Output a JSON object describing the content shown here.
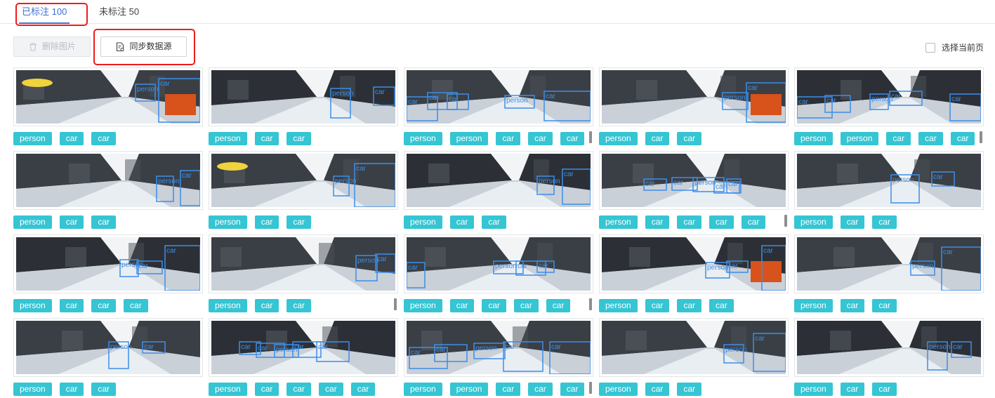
{
  "tabs": {
    "labeled": "已标注 100",
    "unlabeled": "未标注 50"
  },
  "toolbar": {
    "delete_label": "删除图片",
    "sync_label": "同步数据源",
    "select_page_label": "选择当前页"
  },
  "colors": {
    "accent": "#3b6fd6",
    "tag": "#35c5d3",
    "box": "#3d8de8",
    "highlight": "#ee1c1c"
  },
  "images": [
    {
      "tags": [
        "person",
        "car",
        "car"
      ],
      "boxes": [
        {
          "label": "person"
        },
        {
          "label": "car"
        }
      ]
    },
    {
      "tags": [
        "person",
        "car",
        "car"
      ],
      "boxes": [
        {
          "label": "person"
        },
        {
          "label": "car"
        }
      ]
    },
    {
      "tags": [
        "person",
        "person",
        "car",
        "car",
        "car"
      ],
      "boxes": [
        {
          "label": "car"
        },
        {
          "label": "car"
        },
        {
          "label": "car"
        },
        {
          "label": "person"
        },
        {
          "label": "car"
        }
      ]
    },
    {
      "tags": [
        "person",
        "car",
        "car"
      ],
      "boxes": [
        {
          "label": "person"
        },
        {
          "label": "car"
        }
      ]
    },
    {
      "tags": [
        "person",
        "person",
        "car",
        "car",
        "car"
      ],
      "boxes": [
        {
          "label": "car"
        },
        {
          "label": "car"
        },
        {
          "label": "person"
        },
        {
          "label": "car"
        },
        {
          "label": "car"
        }
      ]
    },
    {
      "tags": [
        "person",
        "car",
        "car"
      ],
      "boxes": [
        {
          "label": "person"
        },
        {
          "label": "car"
        }
      ]
    },
    {
      "tags": [
        "person",
        "car",
        "car"
      ],
      "boxes": [
        {
          "label": "person"
        },
        {
          "label": "car"
        }
      ]
    },
    {
      "tags": [
        "person",
        "car",
        "car"
      ],
      "boxes": [
        {
          "label": "person"
        },
        {
          "label": "car"
        }
      ]
    },
    {
      "tags": [
        "person",
        "car",
        "car",
        "car",
        "car"
      ],
      "boxes": [
        {
          "label": "car"
        },
        {
          "label": "car"
        },
        {
          "label": "person"
        },
        {
          "label": "car"
        },
        {
          "label": "car"
        }
      ]
    },
    {
      "tags": [
        "person",
        "car",
        "car"
      ],
      "boxes": [
        {
          "label": "person"
        },
        {
          "label": "car"
        }
      ]
    },
    {
      "tags": [
        "person",
        "car",
        "car",
        "car"
      ],
      "boxes": [
        {
          "label": "person"
        },
        {
          "label": "car"
        },
        {
          "label": "car"
        }
      ]
    },
    {
      "tags": [
        "person",
        "car",
        "car"
      ],
      "boxes": [
        {
          "label": "person"
        },
        {
          "label": "car"
        }
      ]
    },
    {
      "tags": [
        "person",
        "car",
        "car",
        "car",
        "car"
      ],
      "boxes": [
        {
          "label": "car"
        },
        {
          "label": "person"
        },
        {
          "label": "car"
        },
        {
          "label": "car"
        }
      ]
    },
    {
      "tags": [
        "person",
        "car",
        "car",
        "car"
      ],
      "boxes": [
        {
          "label": "person"
        },
        {
          "label": "car"
        },
        {
          "label": "car"
        }
      ]
    },
    {
      "tags": [
        "person",
        "car",
        "car"
      ],
      "boxes": [
        {
          "label": "person"
        },
        {
          "label": "car"
        }
      ]
    },
    {
      "tags": [
        "person",
        "car",
        "car"
      ],
      "boxes": [
        {
          "label": "person"
        },
        {
          "label": "car"
        }
      ]
    },
    {
      "tags": [
        "person",
        "car",
        "car",
        "car",
        "car"
      ],
      "boxes": [
        {
          "label": "car"
        },
        {
          "label": "car"
        },
        {
          "label": "person"
        },
        {
          "label": "car"
        },
        {
          "label": "car"
        }
      ]
    },
    {
      "tags": [
        "person",
        "person",
        "car",
        "car",
        "car"
      ],
      "boxes": [
        {
          "label": "car"
        },
        {
          "label": "car"
        },
        {
          "label": "person"
        },
        {
          "label": "car"
        },
        {
          "label": "car"
        }
      ]
    },
    {
      "tags": [
        "person",
        "car",
        "car"
      ],
      "boxes": [
        {
          "label": "person"
        },
        {
          "label": "car"
        }
      ]
    },
    {
      "tags": [
        "person",
        "car",
        "car"
      ],
      "boxes": [
        {
          "label": "person"
        },
        {
          "label": "car"
        }
      ]
    }
  ]
}
